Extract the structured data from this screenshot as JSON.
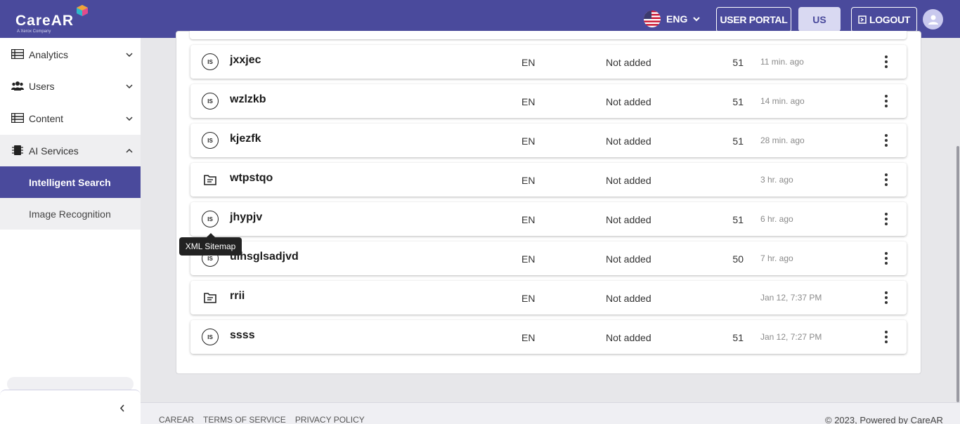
{
  "header": {
    "logo_text": "CareAR",
    "logo_sub": "A Xerox Company",
    "language": "ENG",
    "user_portal": "USER PORTAL",
    "region": "US",
    "logout": "LOGOUT"
  },
  "sidebar": {
    "items": [
      {
        "label": "Analytics",
        "icon": "table-icon"
      },
      {
        "label": "Users",
        "icon": "users-icon"
      },
      {
        "label": "Content",
        "icon": "table-icon"
      },
      {
        "label": "AI Services",
        "icon": "chip-icon"
      }
    ],
    "sub_items": [
      {
        "label": "Intelligent Search",
        "active": true
      },
      {
        "label": "Image Recognition",
        "active": false
      }
    ]
  },
  "rows": [
    {
      "icon": "is-badge",
      "badge": "IS",
      "name": "jxxjec",
      "lang": "EN",
      "status": "Not added",
      "count": "51",
      "time": "11 min. ago"
    },
    {
      "icon": "is-badge",
      "badge": "IS",
      "name": "wzlzkb",
      "lang": "EN",
      "status": "Not added",
      "count": "51",
      "time": "14 min. ago"
    },
    {
      "icon": "is-badge",
      "badge": "IS",
      "name": "kjezfk",
      "lang": "EN",
      "status": "Not added",
      "count": "51",
      "time": "28 min. ago"
    },
    {
      "icon": "document-icon",
      "badge": "",
      "name": "wtpstqo",
      "lang": "EN",
      "status": "Not added",
      "count": "",
      "time": "3 hr. ago"
    },
    {
      "icon": "is-badge",
      "badge": "IS",
      "name": "jhypjv",
      "lang": "EN",
      "status": "Not added",
      "count": "51",
      "time": "6 hr. ago"
    },
    {
      "icon": "is-badge",
      "badge": "IS",
      "name": "uihsglsadjvd",
      "lang": "EN",
      "status": "Not added",
      "count": "50",
      "time": "7 hr. ago"
    },
    {
      "icon": "document-icon",
      "badge": "",
      "name": "rrii",
      "lang": "EN",
      "status": "Not added",
      "count": "",
      "time": "Jan 12, 7:37 PM"
    },
    {
      "icon": "is-badge",
      "badge": "IS",
      "name": "ssss",
      "lang": "EN",
      "status": "Not added",
      "count": "51",
      "time": "Jan 12, 7:27 PM"
    }
  ],
  "tooltip": "XML Sitemap",
  "footer": {
    "links": [
      "CAREAR",
      "TERMS OF SERVICE",
      "PRIVACY POLICY"
    ],
    "copyright": "© 2023, Powered by CareAR"
  },
  "colors": {
    "brand": "#4a4a9c",
    "active_nav": "#4a4a9c",
    "background": "#e7e7ea"
  }
}
